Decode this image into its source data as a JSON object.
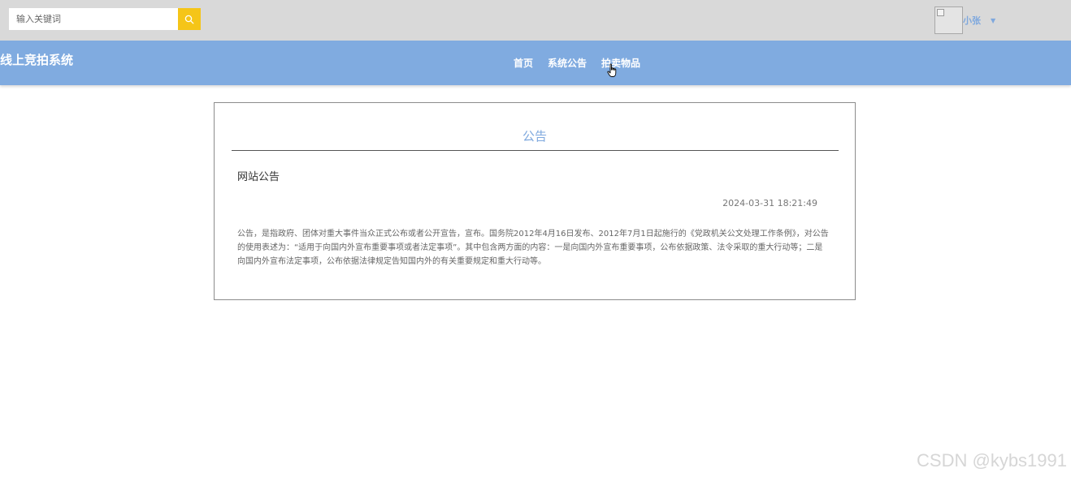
{
  "search": {
    "placeholder": "输入关键词",
    "icon": "search-icon"
  },
  "user": {
    "name": "小张",
    "avatar_icon": "broken-image-icon",
    "dropdown_icon": "caret-down-icon"
  },
  "brand": {
    "title": "线上竞拍系统"
  },
  "nav": {
    "items": [
      {
        "label": "首页"
      },
      {
        "label": "系统公告"
      },
      {
        "label": "拍卖物品"
      }
    ]
  },
  "notice": {
    "section_title": "公告",
    "title": "网站公告",
    "time": "2024-03-31 18:21:49",
    "body": "公告，是指政府、团体对重大事件当众正式公布或者公开宣告，宣布。国务院2012年4月16日发布、2012年7月1日起施行的《党政机关公文处理工作条例》，对公告的使用表述为：“适用于向国内外宣布重要事项或者法定事项”。其中包含两方面的内容：一是向国内外宣布重要事项，公布依据政策、法令采取的重大行动等；二是向国内外宣布法定事项，公布依据法律规定告知国内外的有关重要规定和重大行动等。"
  },
  "watermark": {
    "text": "CSDN @kybs1991"
  },
  "colors": {
    "topbar": "#d9d9d9",
    "navbar": "#80abe0",
    "accent": "#7ea8de",
    "search_button": "#f5c518"
  }
}
